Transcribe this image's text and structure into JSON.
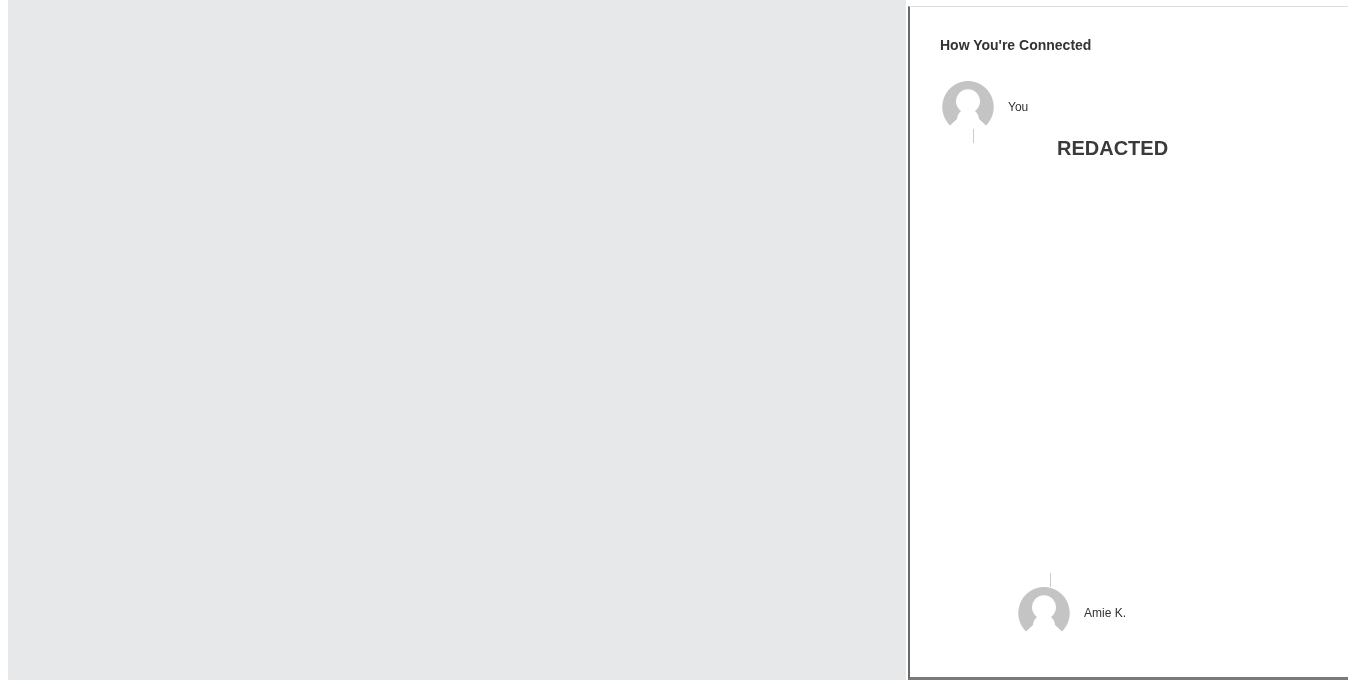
{
  "connections": {
    "title": "How You're Connected",
    "people": [
      {
        "name": "You"
      },
      {
        "name": "Amie K."
      }
    ],
    "redacted_label": "REDACTED"
  }
}
